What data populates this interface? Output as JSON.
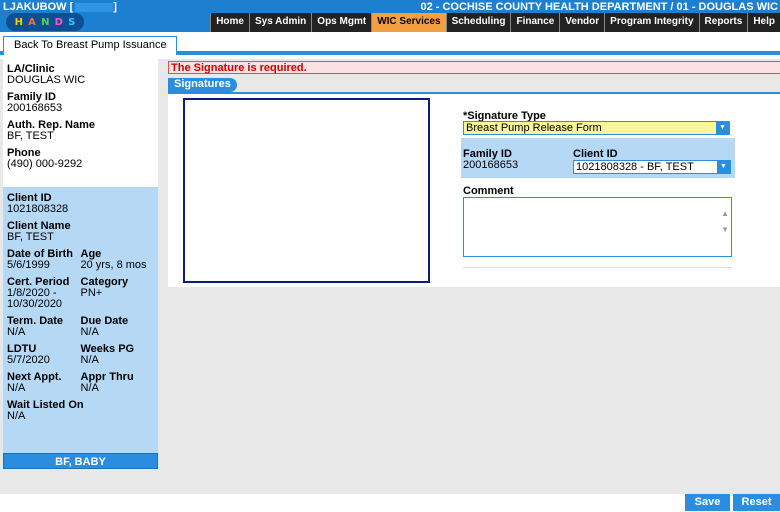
{
  "header": {
    "user": "LJAKUBOW [",
    "user_suffix": "]",
    "agency": "02 - COCHISE COUNTY HEALTH DEPARTMENT / 01 - DOUGLAS WIC",
    "logo_letters": [
      "H",
      "A",
      "N",
      "D",
      "S"
    ],
    "logo_colors": [
      "#f5d000",
      "#ff6a3d",
      "#57d14a",
      "#ff57b5",
      "#3ec7ff"
    ]
  },
  "nav": [
    "Home",
    "Sys Admin",
    "Ops Mgmt",
    "WIC Services",
    "Scheduling",
    "Finance",
    "Vendor",
    "Program Integrity",
    "Reports",
    "Help"
  ],
  "nav_active": "WIC Services",
  "back_button": "Back To Breast Pump Issuance",
  "sidebar": {
    "la_clinic_label": "LA/Clinic",
    "la_clinic_value": "DOUGLAS WIC",
    "family_id_label": "Family ID",
    "family_id_value": "200168653",
    "auth_rep_label": "Auth. Rep. Name",
    "auth_rep_value": "BF, TEST",
    "phone_label": "Phone",
    "phone_value": "(490) 000-9292",
    "client_id_label": "Client ID",
    "client_id_value": "1021808328",
    "client_name_label": "Client Name",
    "client_name_value": "BF, TEST",
    "dob_label": "Date of Birth",
    "dob_value": "5/6/1999",
    "age_label": "Age",
    "age_value": "20 yrs, 8 mos",
    "cert_label": "Cert. Period",
    "cert_value_1": "1/8/2020 -",
    "cert_value_2": "10/30/2020",
    "category_label": "Category",
    "category_value": "PN+",
    "term_label": "Term. Date",
    "term_value": "N/A",
    "due_label": "Due Date",
    "due_value": "N/A",
    "ldtu_label": "LDTU",
    "ldtu_value": "5/7/2020",
    "weeks_label": "Weeks PG",
    "weeks_value": "N/A",
    "next_label": "Next Appt.",
    "next_value": "N/A",
    "appr_label": "Appr Thru",
    "appr_value": "N/A",
    "wait_label": "Wait Listed On",
    "wait_value": "N/A",
    "baby_button": "BF, BABY"
  },
  "main": {
    "error": "The Signature is required.",
    "section_title": "Signatures",
    "sig_type_label": "*Signature Type",
    "sig_type_value": "Breast Pump Release Form",
    "family_id_label": "Family ID",
    "family_id_value": "200168653",
    "client_id_label": "Client ID",
    "client_id_value": "1021808328 - BF, TEST",
    "comment_label": "Comment",
    "comment_value": ""
  },
  "buttons": {
    "save": "Save",
    "reset": "Reset"
  },
  "colors": {
    "accent": "#2a8de0",
    "active_tab": "#f3a043",
    "sidebar_blue": "#b5d8f5",
    "error": "#c00000",
    "select_bg": "#fbf59b"
  }
}
